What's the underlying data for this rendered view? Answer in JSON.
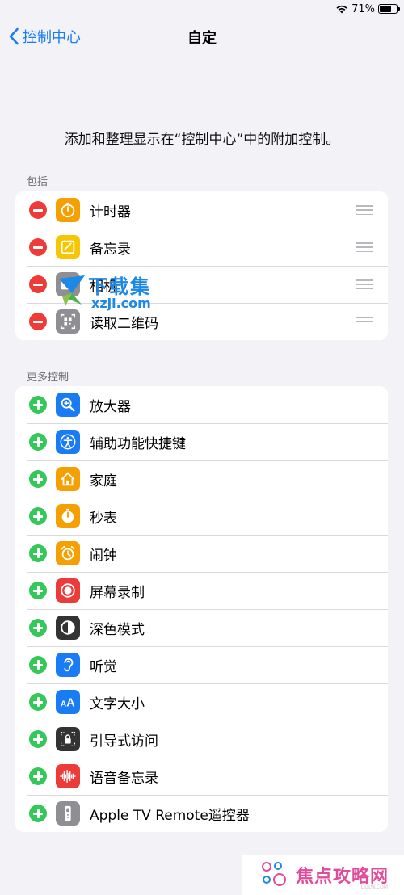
{
  "status_bar": {
    "battery_text": "71%",
    "battery_level": 0.71
  },
  "nav": {
    "back_label": "控制中心",
    "title": "自定"
  },
  "description": "添加和整理显示在“控制中心”中的附加控制。",
  "included": {
    "header": "包括",
    "items": [
      {
        "label": "计时器",
        "icon": "timer-icon",
        "color": "#f59f00"
      },
      {
        "label": "备忘录",
        "icon": "notes-icon",
        "color": "#f7c600"
      },
      {
        "label": "相机",
        "icon": "camera-icon",
        "color": "#8e8e93"
      },
      {
        "label": "读取二维码",
        "icon": "qr-code-icon",
        "color": "#8e8e93"
      }
    ]
  },
  "more": {
    "header": "更多控制",
    "items": [
      {
        "label": "放大器",
        "icon": "magnifier-icon",
        "color": "#1a7cf4"
      },
      {
        "label": "辅助功能快捷键",
        "icon": "accessibility-icon",
        "color": "#1a7cf4"
      },
      {
        "label": "家庭",
        "icon": "home-icon",
        "color": "#f59f00"
      },
      {
        "label": "秒表",
        "icon": "stopwatch-icon",
        "color": "#f59f00"
      },
      {
        "label": "闹钟",
        "icon": "alarm-icon",
        "color": "#f59f00"
      },
      {
        "label": "屏幕录制",
        "icon": "screen-record-icon",
        "color": "#ec3b38"
      },
      {
        "label": "深色模式",
        "icon": "dark-mode-icon",
        "color": "#333333"
      },
      {
        "label": "听觉",
        "icon": "hearing-icon",
        "color": "#1a7cf4"
      },
      {
        "label": "文字大小",
        "icon": "text-size-icon",
        "color": "#1a7cf4"
      },
      {
        "label": "引导式访问",
        "icon": "guided-access-icon",
        "color": "#333333"
      },
      {
        "label": "语音备忘录",
        "icon": "voice-memos-icon",
        "color": "#ec3b38"
      },
      {
        "label": "Apple TV Remote遥控器",
        "icon": "apple-tv-remote-icon",
        "color": "#8e8e93"
      }
    ]
  },
  "watermarks": {
    "center_top": "下载集",
    "center_bottom": "xzji.com",
    "footer": "焦点攻略网",
    "footer_sub": "JDGLW.COM"
  },
  "colors": {
    "accent": "#1a7cf4",
    "remove": "#ee3b37",
    "add": "#34c759",
    "background": "#f2f2f7"
  }
}
